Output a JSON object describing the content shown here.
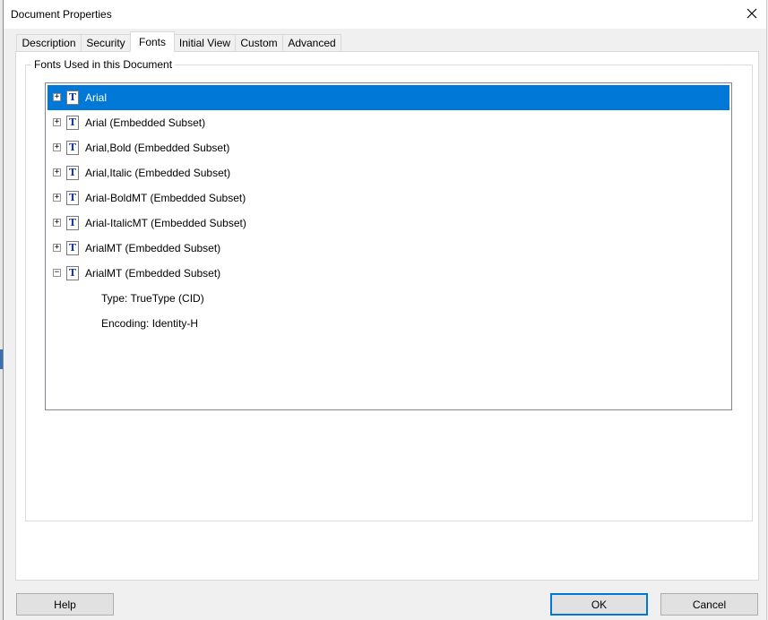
{
  "dialog": {
    "title": "Document Properties"
  },
  "tabs": [
    {
      "label": "Description"
    },
    {
      "label": "Security"
    },
    {
      "label": "Fonts"
    },
    {
      "label": "Initial View"
    },
    {
      "label": "Custom"
    },
    {
      "label": "Advanced"
    }
  ],
  "active_tab": "Fonts",
  "fonts_group": {
    "label": "Fonts Used in this Document",
    "items": [
      {
        "label": "Arial",
        "expander": "+",
        "selected": true
      },
      {
        "label": "Arial (Embedded Subset)",
        "expander": "+"
      },
      {
        "label": "Arial,Bold (Embedded Subset)",
        "expander": "+"
      },
      {
        "label": "Arial,Italic (Embedded Subset)",
        "expander": "+"
      },
      {
        "label": "Arial-BoldMT (Embedded Subset)",
        "expander": "+"
      },
      {
        "label": "Arial-ItalicMT (Embedded Subset)",
        "expander": "+"
      },
      {
        "label": "ArialMT (Embedded Subset)",
        "expander": "+"
      },
      {
        "label": "ArialMT (Embedded Subset)",
        "expander": "−",
        "details": [
          "Type: TrueType (CID)",
          "Encoding: Identity-H"
        ]
      }
    ]
  },
  "buttons": {
    "help": "Help",
    "ok": "OK",
    "cancel": "Cancel"
  },
  "colors": {
    "selection": "#0078d7",
    "font_icon": "#1a3aa0"
  }
}
